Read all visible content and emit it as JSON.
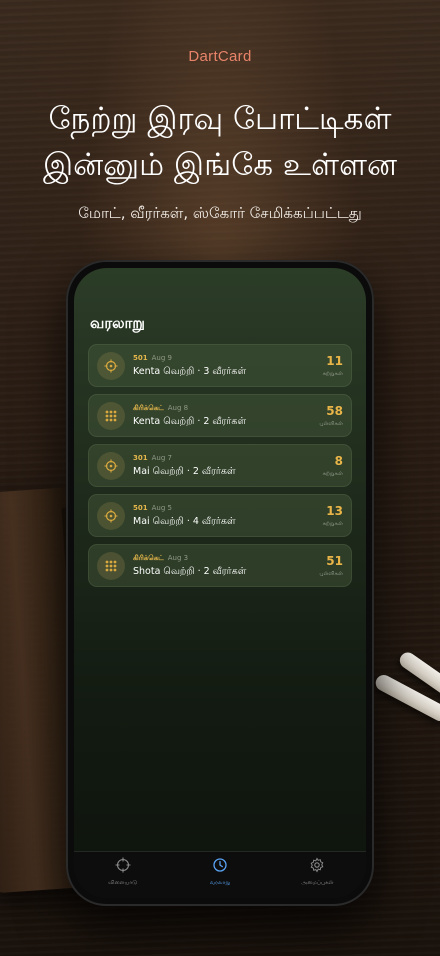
{
  "brand": "DartCard",
  "headline": {
    "line1": "நேற்று இரவு போட்டிகள்",
    "line2": "இன்னும் இங்கே உள்ளன"
  },
  "subline": "மோட், வீரர்கள், ஸ்கோர் சேமிக்கப்பட்டது",
  "screen": {
    "title": "வரலாறு",
    "games": [
      {
        "type": "501",
        "date": "Aug 9",
        "result": "Kenta வெற்றி · 3 வீரர்கள்",
        "score": "11",
        "unit": "சுற்றுகள்",
        "icon": "target-icon"
      },
      {
        "type": "கிரிக்கெட்",
        "date": "Aug 8",
        "result": "Kenta வெற்றி · 2 வீரர்கள்",
        "score": "58",
        "unit": "புள்ளிகள்",
        "icon": "grid-icon"
      },
      {
        "type": "301",
        "date": "Aug 7",
        "result": "Mai வெற்றி · 2 வீரர்கள்",
        "score": "8",
        "unit": "சுற்றுகள்",
        "icon": "target-icon"
      },
      {
        "type": "501",
        "date": "Aug 5",
        "result": "Mai வெற்றி · 4 வீரர்கள்",
        "score": "13",
        "unit": "சுற்றுகள்",
        "icon": "target-icon"
      },
      {
        "type": "கிரிக்கெட்",
        "date": "Aug 3",
        "result": "Shota வெற்றி · 2 வீரர்கள்",
        "score": "51",
        "unit": "புள்ளிகள்",
        "icon": "grid-icon"
      }
    ]
  },
  "tabs": [
    {
      "label": "விளையாடு",
      "icon": "crosshair-icon",
      "active": false
    },
    {
      "label": "வரலாறு",
      "icon": "clock-icon",
      "active": true
    },
    {
      "label": "அமைப்புகள்",
      "icon": "gear-icon",
      "active": false
    }
  ],
  "colors": {
    "brand": "#e8836a",
    "accent_gold": "#e9b548",
    "active_tab": "#5ba3f5"
  }
}
